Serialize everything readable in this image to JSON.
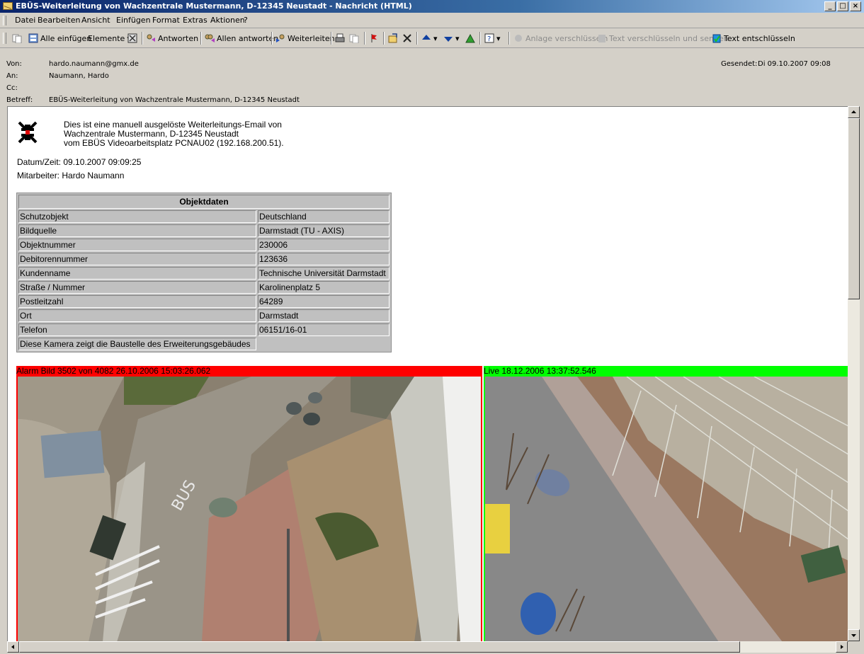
{
  "window": {
    "title": "EBÜS-Weiterleitung von Wachzentrale Mustermann, D-12345 Neustadt - Nachricht (HTML)",
    "minimize": "_",
    "maximize": "□",
    "close": "×"
  },
  "menu": [
    "Datei",
    "Bearbeiten",
    "Ansicht",
    "Einfügen",
    "Format",
    "Extras",
    "Aktionen",
    "?"
  ],
  "toolbar": {
    "insert_all": "Alle einfügen",
    "elements": "Elemente",
    "reply": "Antworten",
    "reply_all": "Allen antworten",
    "forward": "Weiterleiten",
    "encrypt_attachment": "Anlage verschlüsseln",
    "encrypt_send": "Text verschlüsseln und senden",
    "decrypt": "Text entschlüsseln"
  },
  "header": {
    "from_label": "Von:",
    "from": "hardo.naumann@gmx.de",
    "to_label": "An:",
    "to": "Naumann, Hardo",
    "cc_label": "Cc:",
    "cc": "",
    "subject_label": "Betreff:",
    "subject": "EBÜS-Weiterleitung von Wachzentrale Mustermann, D-12345 Neustadt",
    "sent_label": "Gesendet:",
    "sent": "Di 09.10.2007 09:08"
  },
  "body": {
    "intro_line1": "Dies ist eine manuell ausgelöste Weiterleitungs-Email von",
    "intro_line2": "Wachzentrale Mustermann, D-12345 Neustadt",
    "intro_line3": "vom EBÜS Videoarbeitsplatz PCNAU02 (192.168.200.51).",
    "datetime": "Datum/Zeit: 09.10.2007 09:09:25",
    "employee": "Mitarbeiter: Hardo Naumann",
    "table_title": "Objektdaten",
    "rows": [
      {
        "key": "Schutzobjekt",
        "value": "Deutschland"
      },
      {
        "key": "Bildquelle",
        "value": "Darmstadt (TU - AXIS)"
      },
      {
        "key": "Objektnummer",
        "value": "230006"
      },
      {
        "key": "Debitorennummer",
        "value": "123636"
      },
      {
        "key": "Kundenname",
        "value": "Technische Universität Darmstadt"
      },
      {
        "key": "Straße / Nummer",
        "value": "Karolinenplatz 5"
      },
      {
        "key": "Postleitzahl",
        "value": "64289"
      },
      {
        "key": "Ort",
        "value": "Darmstadt"
      },
      {
        "key": "Telefon",
        "value": "06151/16-01"
      }
    ],
    "note": "Diese Kamera zeigt die Baustelle des Erweiterungsgebäudes",
    "alarm_label": "Alarm Bild 3502 von 4082 26.10.2006 15:03:26.062",
    "live_label": "Live 18.12.2006 13:37:52.546",
    "road_marking": "BUS"
  },
  "colors": {
    "alarm": "#ff0000",
    "live": "#00ff00",
    "titlebar": "#0a246a"
  }
}
